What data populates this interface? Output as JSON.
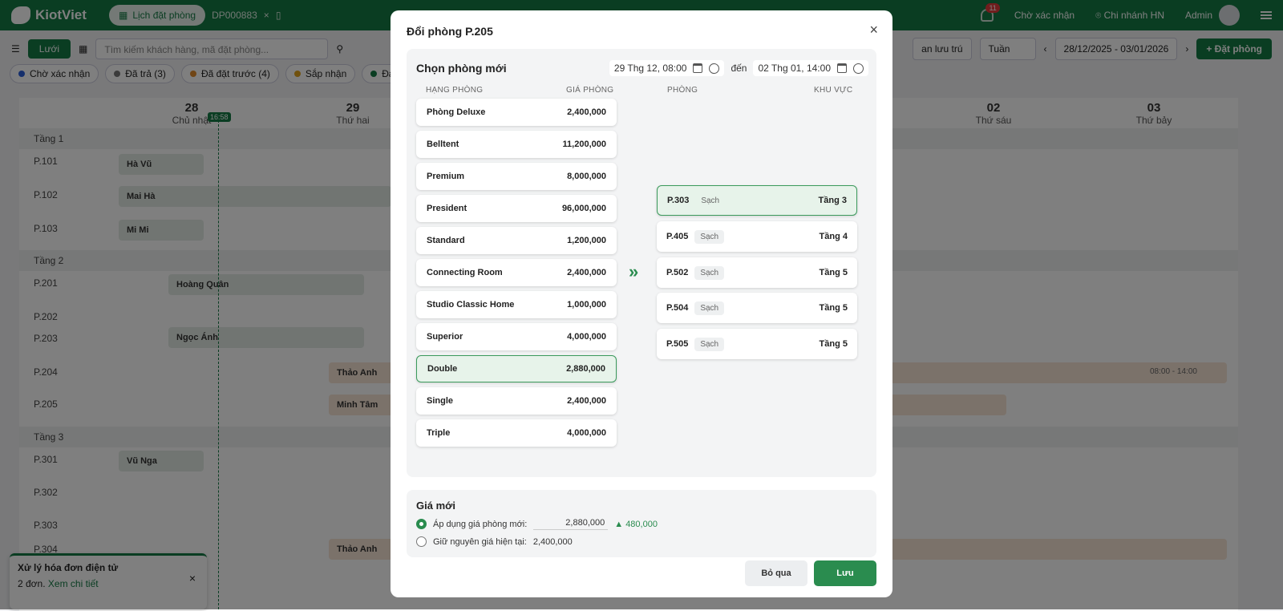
{
  "app": {
    "brand": "KiotViet",
    "tab_active": "Lịch đặt phòng",
    "tab_doc": "DP000883",
    "notif_count": "11",
    "pending": "Chờ xác nhận",
    "branch": "Chi nhánh HN",
    "user": "Admin"
  },
  "toolbar": {
    "view": "Lưới",
    "search_placeholder": "Tìm kiếm khách hàng, mã đặt phòng...",
    "stay": "an lưu trú",
    "period": "Tuần",
    "range": "28/12/2025 - 03/01/2026",
    "book": "Đặt phòng"
  },
  "chips": [
    {
      "label": "Chờ xác nhận",
      "color": "#2b5fd9"
    },
    {
      "label": "Đã trả (3)",
      "color": "#777777"
    },
    {
      "label": "Đã đặt trước (4)",
      "color": "#e08a2b"
    },
    {
      "label": "Sắp nhận",
      "color": "#e0a21b"
    },
    {
      "label": "Đang sử d",
      "color": "#157a45"
    }
  ],
  "calendar": {
    "now": "16:58",
    "days": [
      {
        "num": "28",
        "name": "Chủ nhật"
      },
      {
        "num": "29",
        "name": "Thứ hai"
      },
      {
        "num": "02",
        "name": "Thứ sáu"
      },
      {
        "num": "03",
        "name": "Thứ bảy"
      }
    ],
    "floors": [
      "Tầng 1",
      "Tầng 2",
      "Tầng 3"
    ],
    "rooms": [
      "P.101",
      "P.102",
      "P.103",
      "P.201",
      "P.202",
      "P.203",
      "P.204",
      "P.205",
      "P.301",
      "P.302",
      "P.303",
      "P.304"
    ],
    "bookings": [
      "Hà Vũ",
      "Mai Hà",
      "Mi Mi",
      "Hoàng Quân",
      "Ngọc Ánh",
      "Thảo Anh",
      "Minh Tâm",
      "Vũ Nga",
      "Thảo Anh"
    ],
    "booking_time": "08:00 - 14:00"
  },
  "toast": {
    "title": "Xử lý hóa đơn điện tử",
    "text": "2 đơn.",
    "link": "Xem chi tiết"
  },
  "modal": {
    "title": "Đổi phòng P.205",
    "section_title": "Chọn phòng mới",
    "from": "29 Thg 12, 08:00",
    "to_label": "đến",
    "to": "02 Thg 01, 14:00",
    "col_type": "HẠNG PHÒNG",
    "col_price": "GIÁ PHÒNG",
    "col_room": "PHÒNG",
    "col_area": "KHU VỰC",
    "room_types": [
      {
        "name": "Phòng Deluxe",
        "price": "2,400,000"
      },
      {
        "name": "Belltent",
        "price": "11,200,000"
      },
      {
        "name": "Premium",
        "price": "8,000,000"
      },
      {
        "name": "President",
        "price": "96,000,000"
      },
      {
        "name": "Standard",
        "price": "1,200,000"
      },
      {
        "name": "Connecting Room",
        "price": "2,400,000"
      },
      {
        "name": "Studio Classic Home",
        "price": "1,000,000"
      },
      {
        "name": "Superior",
        "price": "4,000,000"
      },
      {
        "name": "Double",
        "price": "2,880,000"
      },
      {
        "name": "Single",
        "price": "2,400,000"
      },
      {
        "name": "Triple",
        "price": "4,000,000"
      }
    ],
    "rooms": [
      {
        "name": "P.303",
        "status": "Sạch",
        "floor": "Tầng 3"
      },
      {
        "name": "P.405",
        "status": "Sạch",
        "floor": "Tầng 4"
      },
      {
        "name": "P.502",
        "status": "Sạch",
        "floor": "Tầng 5"
      },
      {
        "name": "P.504",
        "status": "Sạch",
        "floor": "Tầng 5"
      },
      {
        "name": "P.505",
        "status": "Sạch",
        "floor": "Tầng 5"
      }
    ],
    "price_title": "Giá mới",
    "opt_new_label": "Áp dụng giá phòng mới:",
    "opt_new_value": "2,880,000",
    "opt_new_diff": "480,000",
    "opt_keep_label": "Giữ nguyên giá hiện tại:",
    "opt_keep_value": "2,400,000",
    "skip": "Bỏ qua",
    "save": "Lưu"
  }
}
